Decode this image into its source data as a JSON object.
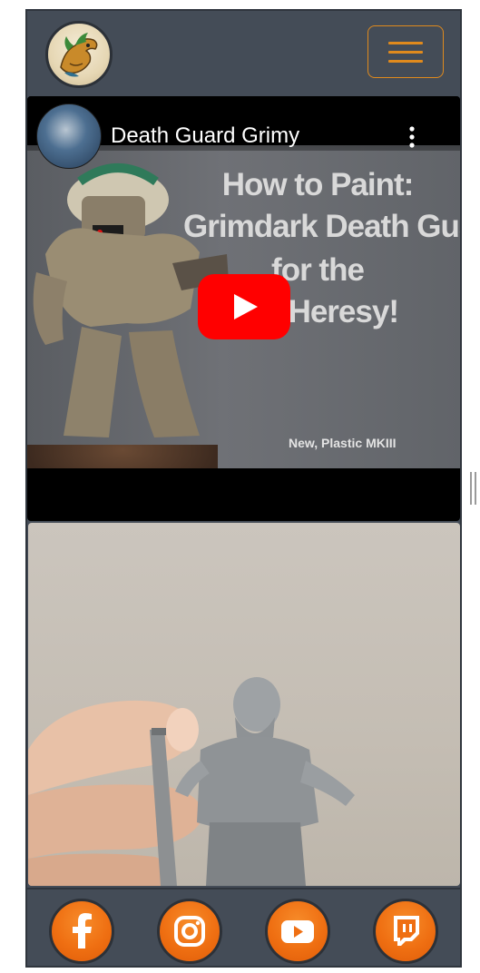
{
  "navbar": {
    "logo_icon": "dragon-logo-icon",
    "menu_icon": "hamburger-menu-icon",
    "accent_color": "#e08a1d"
  },
  "video": {
    "channel_title": "Death Guard Grimy",
    "channel_avatar_icon": "channel-avatar-icon",
    "more_icon": "more-vertical-icon",
    "play_icon": "youtube-play-icon",
    "thumbnail_lines": [
      "How to Paint:",
      "Grimdark Death Gua",
      "for the",
      "us Heresy!"
    ],
    "thumbnail_subtext": "New, Plastic MKIII",
    "play_color": "#ff0000"
  },
  "photo": {
    "subject": "photo-miniature-icon"
  },
  "footer": {
    "social_links": [
      {
        "name": "facebook",
        "icon": "facebook-icon"
      },
      {
        "name": "instagram",
        "icon": "instagram-icon"
      },
      {
        "name": "youtube",
        "icon": "youtube-icon"
      },
      {
        "name": "twitch",
        "icon": "twitch-icon"
      }
    ],
    "social_color": "#ef6f12"
  }
}
